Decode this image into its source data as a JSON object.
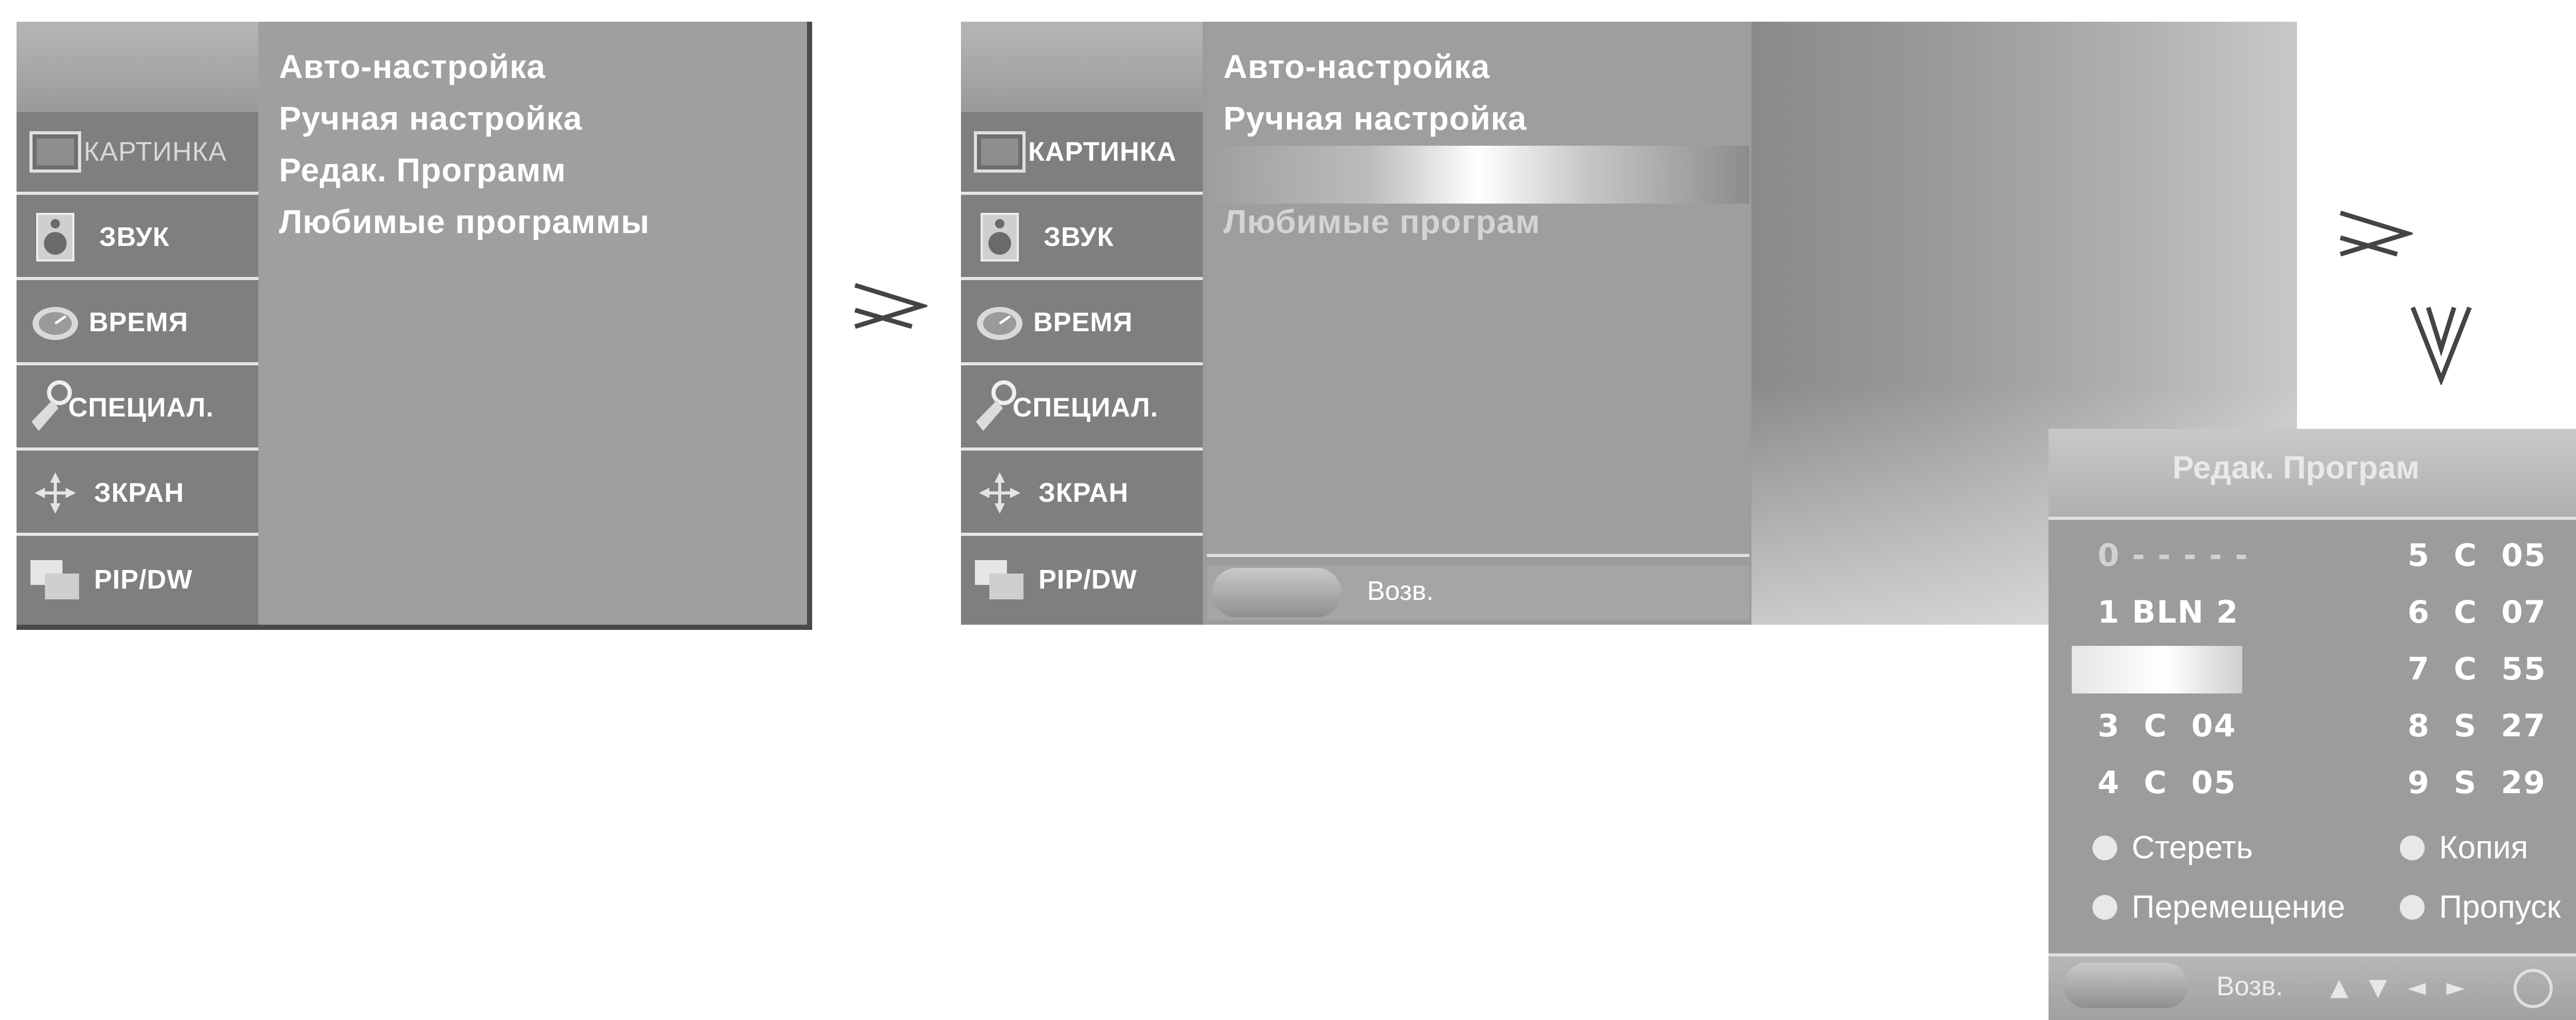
{
  "sidebar": {
    "items": [
      {
        "label": "КАРТИНКА",
        "icon": "picture-icon"
      },
      {
        "label": "ЗВУК",
        "icon": "speaker-icon"
      },
      {
        "label": "ВРЕМЯ",
        "icon": "clock-icon"
      },
      {
        "label": "СПЕЦИАЛ.",
        "icon": "key-icon"
      },
      {
        "label": "ЗКРАН",
        "icon": "screen-arrows-icon"
      },
      {
        "label": "PIP/DW",
        "icon": "pip-icon"
      }
    ]
  },
  "menu1": {
    "items": [
      "Авто-настройка",
      "Ручная настройка",
      "Редак. Программ",
      "Любимые программы"
    ]
  },
  "menu2": {
    "items": [
      "Авто-настройка",
      "Ручная настройка",
      "",
      "Любимые програм"
    ],
    "return_label": "Возв."
  },
  "arrows": {
    "right": "≥",
    "down": "∨"
  },
  "edit_dialog": {
    "title": "Редак. Програм",
    "left_column": [
      "0 - - - - -",
      "1 BLN 2",
      "",
      "3  C  04",
      "4  C  05"
    ],
    "right_column": [
      "5  C  05",
      "6  C  07",
      "7  C  55",
      "8  S  27",
      "9  S  29"
    ],
    "actions": [
      "Стереть",
      "Копия",
      "Перемещение",
      "Пропуск"
    ],
    "return_label": "Возв.",
    "nav": [
      "▲",
      "▼",
      "◄",
      "►"
    ]
  }
}
